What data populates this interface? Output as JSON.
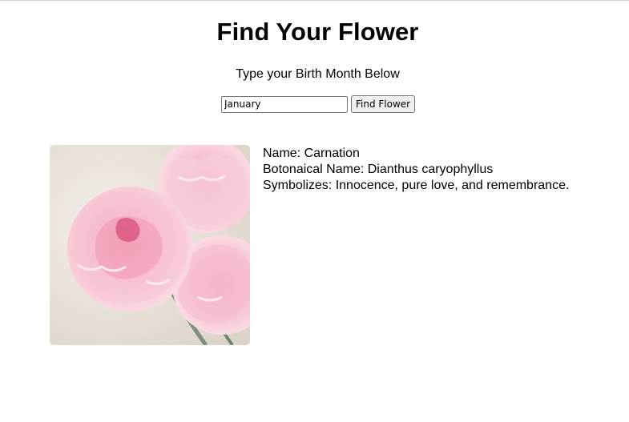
{
  "header": {
    "title": "Find Your Flower",
    "subtitle": "Type your Birth Month Below"
  },
  "search": {
    "value": "January",
    "button_label": "Find Flower"
  },
  "result": {
    "name_line": "Name: Carnation",
    "botanical_line": "Botonaical Name: Dianthus caryophyllus",
    "symbolizes_line": "Symbolizes: Innocence, pure love, and remembrance.",
    "image_subject": "pink-carnation-flowers"
  },
  "colors": {
    "background": "#ffffff",
    "text": "#000000",
    "button_bg": "#efefef",
    "flower_pink": "#f4b8ca",
    "image_backdrop": "#ece6de"
  }
}
